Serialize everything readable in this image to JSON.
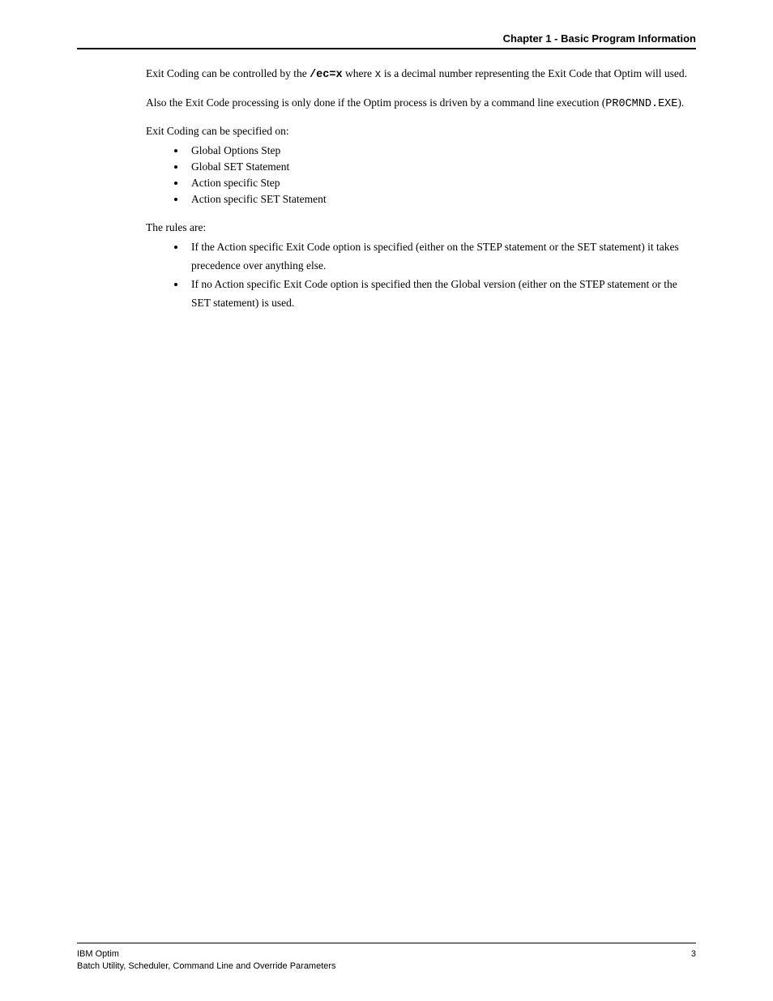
{
  "header": {
    "right": "Chapter 1 - Basic Program Information"
  },
  "p1": {
    "t1": "Exit Coding can be controlled by the ",
    "code1": "/ec=x",
    "t2": " where ",
    "code2": "x",
    "t3": " is a decimal number representing the Exit Code that Optim will used."
  },
  "p2": {
    "t1": "Also the Exit Code processing is only done if the Optim process is driven by a command line execution (",
    "code1": "PR0CMND.EXE",
    "t2": ")."
  },
  "p3_lead": "Exit Coding can be specified on:",
  "p3_items": [
    "Global Options Step",
    "Global SET Statement",
    "Action specific Step",
    "Action specific SET Statement"
  ],
  "p4_lead": "The rules are:",
  "p4_items": [
    "If the Action specific Exit Code option is specified (either on the STEP statement or the SET statement) it takes precedence over anything else.",
    "If no Action specific Exit Code option is specified then the Global version (either on the STEP statement or the SET statement) is used."
  ],
  "footer": {
    "left_line1": "IBM Optim",
    "left_line2": "Batch Utility, Scheduler, Command Line and Override Parameters",
    "page_no": "3"
  }
}
